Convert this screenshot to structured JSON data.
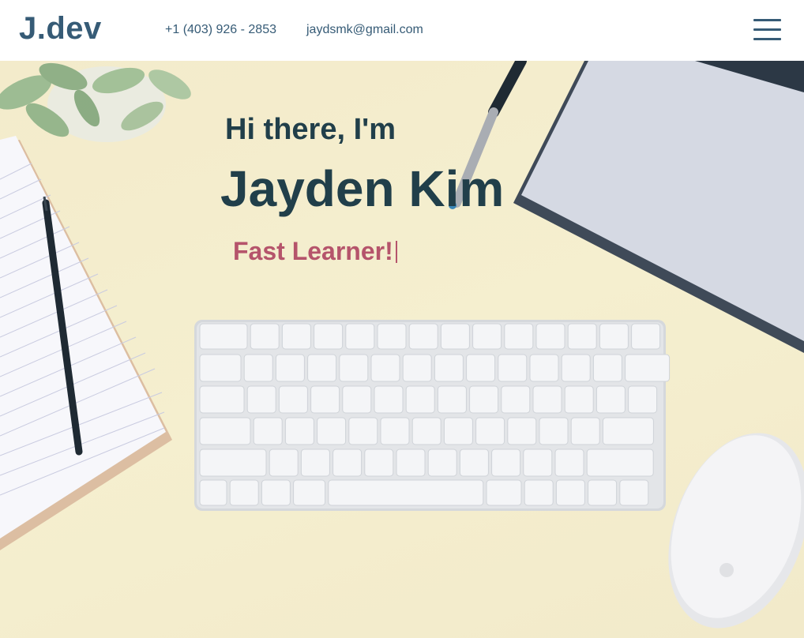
{
  "header": {
    "logo": "J.dev",
    "phone": "+1 (403) 926 - 2853",
    "email": "jaydsmk@gmail.com",
    "menu_icon": "hamburger-menu-icon"
  },
  "hero": {
    "greeting": "Hi there, I'm",
    "name": "Jayden Kim",
    "tagline": "Fast Learner!"
  },
  "colors": {
    "brand": "#365b76",
    "heading": "#213f4a",
    "accent": "#b5546b",
    "background": "#f3ecc9"
  }
}
